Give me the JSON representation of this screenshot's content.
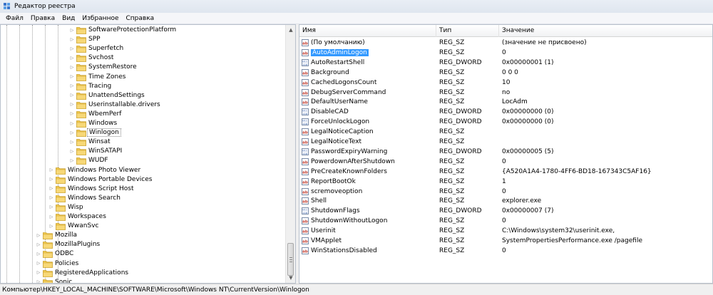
{
  "window": {
    "title": "Редактор реестра"
  },
  "menu": [
    "Файл",
    "Правка",
    "Вид",
    "Избранное",
    "Справка"
  ],
  "tree": {
    "items": [
      {
        "label": "SoftwareProtectionPlatform",
        "level": 3,
        "selected": false
      },
      {
        "label": "SPP",
        "level": 3,
        "selected": false
      },
      {
        "label": "Superfetch",
        "level": 3,
        "selected": false
      },
      {
        "label": "Svchost",
        "level": 3,
        "selected": false
      },
      {
        "label": "SystemRestore",
        "level": 3,
        "selected": false
      },
      {
        "label": "Time Zones",
        "level": 3,
        "selected": false
      },
      {
        "label": "Tracing",
        "level": 3,
        "selected": false
      },
      {
        "label": "UnattendSettings",
        "level": 3,
        "selected": false
      },
      {
        "label": "Userinstallable.drivers",
        "level": 3,
        "selected": false
      },
      {
        "label": "WbemPerf",
        "level": 3,
        "selected": false
      },
      {
        "label": "Windows",
        "level": 3,
        "selected": false
      },
      {
        "label": "Winlogon",
        "level": 3,
        "selected": true
      },
      {
        "label": "Winsat",
        "level": 3,
        "selected": false
      },
      {
        "label": "WinSATAPI",
        "level": 3,
        "selected": false
      },
      {
        "label": "WUDF",
        "level": 3,
        "selected": false
      },
      {
        "label": "Windows Photo Viewer",
        "level": 2,
        "selected": false
      },
      {
        "label": "Windows Portable Devices",
        "level": 2,
        "selected": false
      },
      {
        "label": "Windows Script Host",
        "level": 2,
        "selected": false
      },
      {
        "label": "Windows Search",
        "level": 2,
        "selected": false
      },
      {
        "label": "Wisp",
        "level": 2,
        "selected": false
      },
      {
        "label": "Workspaces",
        "level": 2,
        "selected": false
      },
      {
        "label": "WwanSvc",
        "level": 2,
        "selected": false
      },
      {
        "label": "Mozilla",
        "level": 1,
        "selected": false
      },
      {
        "label": "MozillaPlugins",
        "level": 1,
        "selected": false
      },
      {
        "label": "ODBC",
        "level": 1,
        "selected": false
      },
      {
        "label": "Policies",
        "level": 1,
        "selected": false
      },
      {
        "label": "RegisteredApplications",
        "level": 1,
        "selected": false
      },
      {
        "label": "Sonic",
        "level": 1,
        "selected": false
      }
    ]
  },
  "list": {
    "columns": [
      "Имя",
      "Тип",
      "Значение"
    ],
    "rows": [
      {
        "name": "(По умолчанию)",
        "type": "REG_SZ",
        "value": "(значение не присвоено)",
        "icon": "string",
        "selected": false
      },
      {
        "name": "AutoAdminLogon",
        "type": "REG_SZ",
        "value": "0",
        "icon": "string",
        "selected": true
      },
      {
        "name": "AutoRestartShell",
        "type": "REG_DWORD",
        "value": "0x00000001 (1)",
        "icon": "dword",
        "selected": false
      },
      {
        "name": "Background",
        "type": "REG_SZ",
        "value": "0 0 0",
        "icon": "string",
        "selected": false
      },
      {
        "name": "CachedLogonsCount",
        "type": "REG_SZ",
        "value": "10",
        "icon": "string",
        "selected": false
      },
      {
        "name": "DebugServerCommand",
        "type": "REG_SZ",
        "value": "no",
        "icon": "string",
        "selected": false
      },
      {
        "name": "DefaultUserName",
        "type": "REG_SZ",
        "value": "LocAdm",
        "icon": "string",
        "selected": false
      },
      {
        "name": "DisableCAD",
        "type": "REG_DWORD",
        "value": "0x00000000 (0)",
        "icon": "dword",
        "selected": false
      },
      {
        "name": "ForceUnlockLogon",
        "type": "REG_DWORD",
        "value": "0x00000000 (0)",
        "icon": "dword",
        "selected": false
      },
      {
        "name": "LegalNoticeCaption",
        "type": "REG_SZ",
        "value": "",
        "icon": "string",
        "selected": false
      },
      {
        "name": "LegalNoticeText",
        "type": "REG_SZ",
        "value": "",
        "icon": "string",
        "selected": false
      },
      {
        "name": "PasswordExpiryWarning",
        "type": "REG_DWORD",
        "value": "0x00000005 (5)",
        "icon": "dword",
        "selected": false
      },
      {
        "name": "PowerdownAfterShutdown",
        "type": "REG_SZ",
        "value": "0",
        "icon": "string",
        "selected": false
      },
      {
        "name": "PreCreateKnownFolders",
        "type": "REG_SZ",
        "value": "{A520A1A4-1780-4FF6-BD18-167343C5AF16}",
        "icon": "string",
        "selected": false
      },
      {
        "name": "ReportBootOk",
        "type": "REG_SZ",
        "value": "1",
        "icon": "string",
        "selected": false
      },
      {
        "name": "scremoveoption",
        "type": "REG_SZ",
        "value": "0",
        "icon": "string",
        "selected": false
      },
      {
        "name": "Shell",
        "type": "REG_SZ",
        "value": "explorer.exe",
        "icon": "string",
        "selected": false
      },
      {
        "name": "ShutdownFlags",
        "type": "REG_DWORD",
        "value": "0x00000007 (7)",
        "icon": "dword",
        "selected": false
      },
      {
        "name": "ShutdownWithoutLogon",
        "type": "REG_SZ",
        "value": "0",
        "icon": "string",
        "selected": false
      },
      {
        "name": "Userinit",
        "type": "REG_SZ",
        "value": "C:\\Windows\\system32\\userinit.exe,",
        "icon": "string",
        "selected": false
      },
      {
        "name": "VMApplet",
        "type": "REG_SZ",
        "value": "SystemPropertiesPerformance.exe /pagefile",
        "icon": "string",
        "selected": false
      },
      {
        "name": "WinStationsDisabled",
        "type": "REG_SZ",
        "value": "0",
        "icon": "string",
        "selected": false
      }
    ]
  },
  "status": {
    "path": "Компьютер\\HKEY_LOCAL_MACHINE\\SOFTWARE\\Microsoft\\Windows NT\\CurrentVersion\\Winlogon"
  },
  "colors": {
    "selection": "#3399ff",
    "folder": "#f2c94c",
    "string_icon": "#c0392b",
    "dword_icon": "#2e5aac"
  }
}
